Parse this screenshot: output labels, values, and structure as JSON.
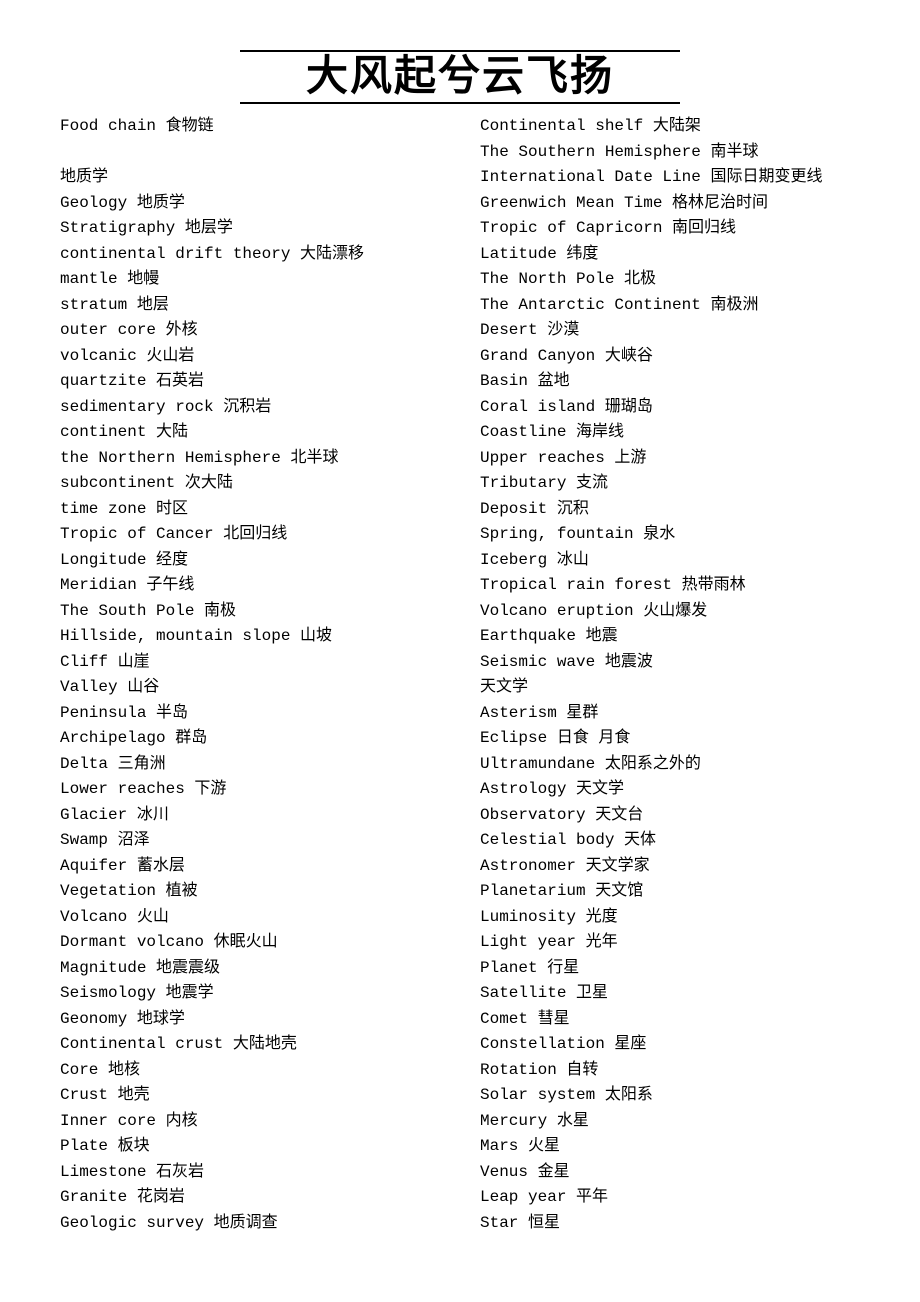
{
  "header_title": "大风起兮云飞扬",
  "left_column": [
    "Food chain 食物链",
    "",
    "地质学",
    "Geology 地质学",
    "Stratigraphy 地层学",
    "continental drift theory 大陆漂移",
    "mantle 地幔",
    "stratum 地层",
    "outer core 外核",
    "volcanic 火山岩",
    "quartzite 石英岩",
    "sedimentary rock 沉积岩",
    "continent 大陆",
    "the Northern Hemisphere 北半球",
    "subcontinent 次大陆",
    "time zone 时区",
    "Tropic of Cancer 北回归线",
    "Longitude 经度",
    "Meridian 子午线",
    "The South Pole 南极",
    "Hillside, mountain slope 山坡",
    "Cliff 山崖",
    "Valley 山谷",
    "Peninsula 半岛",
    "Archipelago 群岛",
    "Delta 三角洲",
    "Lower reaches 下游",
    "Glacier 冰川",
    "Swamp 沼泽",
    "Aquifer 蓄水层",
    "Vegetation 植被",
    "Volcano 火山",
    "Dormant volcano 休眠火山",
    "Magnitude 地震震级",
    "Seismology 地震学",
    "Geonomy 地球学",
    "Continental crust 大陆地壳",
    "Core 地核",
    "Crust 地壳",
    "Inner core 内核",
    "Plate 板块",
    "Limestone 石灰岩",
    "Granite 花岗岩",
    "Geologic survey 地质调查"
  ],
  "right_column": [
    "Continental shelf 大陆架",
    "The Southern Hemisphere 南半球",
    "International Date Line 国际日期变更线",
    "Greenwich Mean Time 格林尼治时间",
    "Tropic of Capricorn 南回归线",
    "Latitude 纬度",
    "The North Pole 北极",
    "The Antarctic Continent 南极洲",
    "Desert 沙漠",
    "Grand Canyon 大峡谷",
    "Basin 盆地",
    "Coral island 珊瑚岛",
    "Coastline 海岸线",
    "Upper reaches 上游",
    "Tributary 支流",
    "Deposit 沉积",
    "Spring, fountain 泉水",
    "Iceberg 冰山",
    "Tropical rain forest 热带雨林",
    "Volcano eruption 火山爆发",
    "Earthquake 地震",
    "Seismic wave 地震波",
    "天文学",
    "Asterism 星群",
    "Eclipse 日食 月食",
    "Ultramundane 太阳系之外的",
    "Astrology 天文学",
    "Observatory 天文台",
    "Celestial body 天体",
    "Astronomer 天文学家",
    "Planetarium 天文馆",
    "Luminosity 光度",
    "Light year 光年",
    "Planet 行星",
    "Satellite 卫星",
    "Comet 彗星",
    "Constellation 星座",
    "Rotation 自转",
    "Solar system 太阳系",
    "Mercury 水星",
    "Mars 火星",
    "Venus 金星",
    "Leap year 平年",
    "Star 恒星"
  ]
}
